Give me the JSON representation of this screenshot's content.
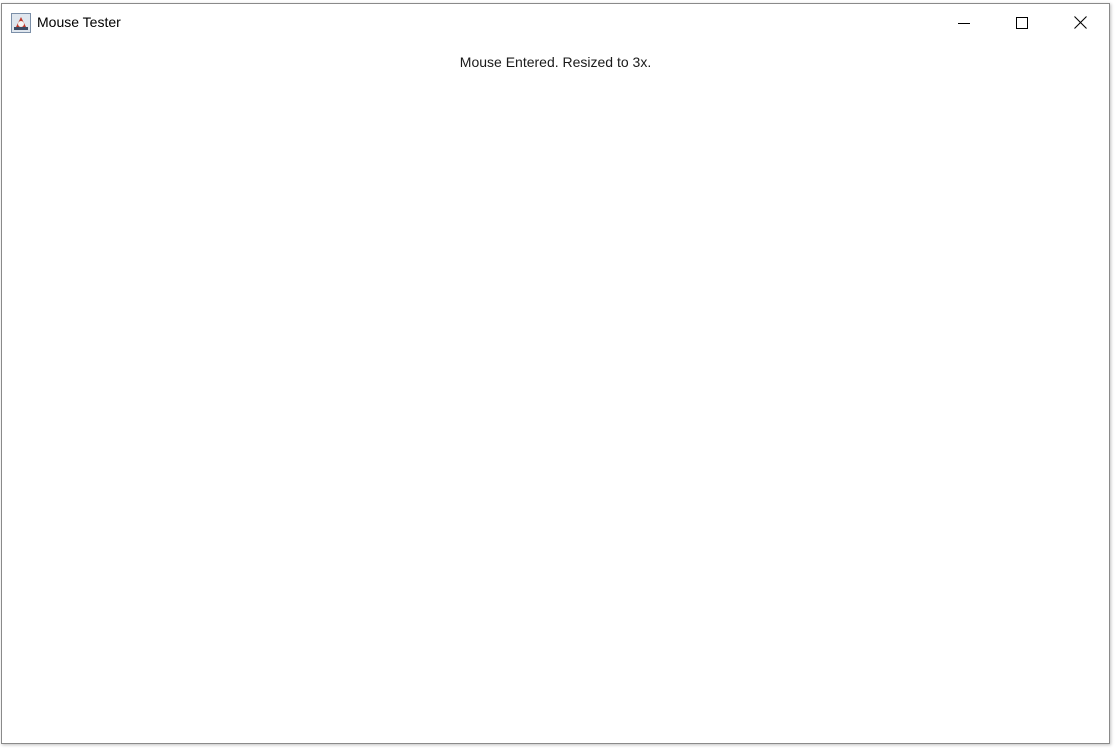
{
  "window": {
    "title": "Mouse Tester",
    "app_icon": "java-coffee-cup-icon",
    "controls": {
      "minimize_icon": "minimize-icon",
      "maximize_icon": "maximize-icon",
      "close_icon": "close-icon"
    }
  },
  "content": {
    "status_text": "Mouse Entered. Resized to 3x."
  },
  "colors": {
    "background": "#ffffff",
    "border": "#8a8a8a",
    "text": "#1a1a1a"
  }
}
